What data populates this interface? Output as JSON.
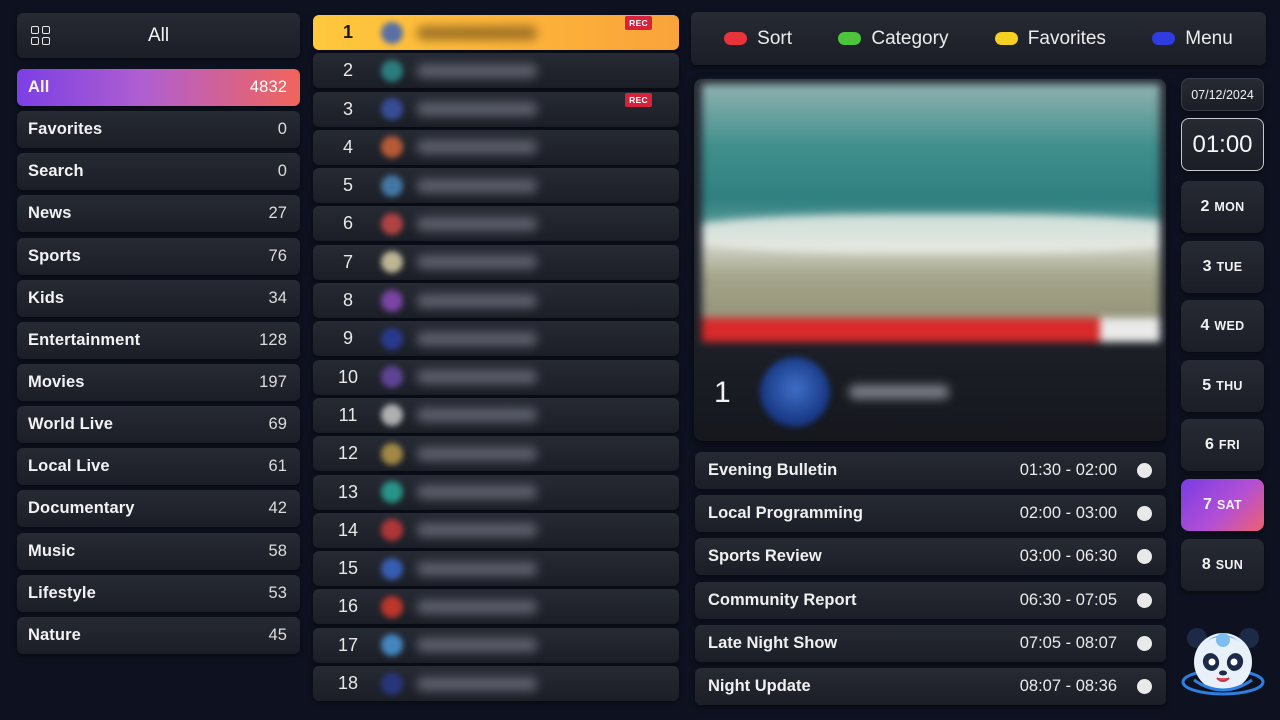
{
  "categories_header": {
    "title": "All"
  },
  "categories": [
    {
      "label": "All",
      "count": "4832",
      "active": true
    },
    {
      "label": "Favorites",
      "count": "0"
    },
    {
      "label": "Search",
      "count": "0"
    },
    {
      "label": "News",
      "count": "27"
    },
    {
      "label": "Sports",
      "count": "76"
    },
    {
      "label": "Kids",
      "count": "34"
    },
    {
      "label": "Entertainment",
      "count": "128"
    },
    {
      "label": "Movies",
      "count": "197"
    },
    {
      "label": "World Live",
      "count": "69"
    },
    {
      "label": "Local Live",
      "count": "61"
    },
    {
      "label": "Documentary",
      "count": "42"
    },
    {
      "label": "Music",
      "count": "58"
    },
    {
      "label": "Lifestyle",
      "count": "53"
    },
    {
      "label": "Nature",
      "count": "45"
    }
  ],
  "channels": [
    {
      "num": "1",
      "rec": "REC",
      "active": true,
      "logo_color": "#3a62b8"
    },
    {
      "num": "2",
      "logo_color": "#2d8c8c"
    },
    {
      "num": "3",
      "rec": "REC",
      "logo_color": "#3a55a8"
    },
    {
      "num": "4",
      "logo_color": "#d0643a"
    },
    {
      "num": "5",
      "logo_color": "#4a86b8"
    },
    {
      "num": "6",
      "logo_color": "#c84848"
    },
    {
      "num": "7",
      "logo_color": "#d8d0a8"
    },
    {
      "num": "8",
      "logo_color": "#8a4ab8"
    },
    {
      "num": "9",
      "logo_color": "#2a3ea0"
    },
    {
      "num": "10",
      "logo_color": "#6a4aa8"
    },
    {
      "num": "11",
      "logo_color": "#c8c8c8"
    },
    {
      "num": "12",
      "logo_color": "#b89a48"
    },
    {
      "num": "13",
      "logo_color": "#2aa898"
    },
    {
      "num": "14",
      "logo_color": "#c83a3a"
    },
    {
      "num": "15",
      "logo_color": "#3a68c8"
    },
    {
      "num": "16",
      "logo_color": "#d83a2a"
    },
    {
      "num": "17",
      "logo_color": "#4a98d8"
    },
    {
      "num": "18",
      "logo_color": "#2a3a8a"
    }
  ],
  "keys": [
    {
      "label": "Sort",
      "color": "#e8333a"
    },
    {
      "label": "Category",
      "color": "#4cc43c"
    },
    {
      "label": "Favorites",
      "color": "#f5d020"
    },
    {
      "label": "Menu",
      "color": "#2f3de0"
    }
  ],
  "preview": {
    "channel_num": "1"
  },
  "epg": [
    {
      "title": "Evening Bulletin",
      "time": "01:30 - 02:00"
    },
    {
      "title": "Local Programming",
      "time": "02:00 - 03:00"
    },
    {
      "title": "Sports Review",
      "time": "03:00 - 06:30"
    },
    {
      "title": "Community Report",
      "time": "06:30 - 07:05"
    },
    {
      "title": "Late Night Show",
      "time": "07:05 - 08:07"
    },
    {
      "title": "Night Update",
      "time": "08:07 - 08:36"
    }
  ],
  "date": "07/12/2024",
  "clock": "01:00",
  "days": [
    {
      "d": "2",
      "w": "MON"
    },
    {
      "d": "3",
      "w": "TUE"
    },
    {
      "d": "4",
      "w": "WED"
    },
    {
      "d": "5",
      "w": "THU"
    },
    {
      "d": "6",
      "w": "FRI"
    },
    {
      "d": "7",
      "w": "SAT",
      "active": true
    },
    {
      "d": "8",
      "w": "SUN"
    }
  ]
}
